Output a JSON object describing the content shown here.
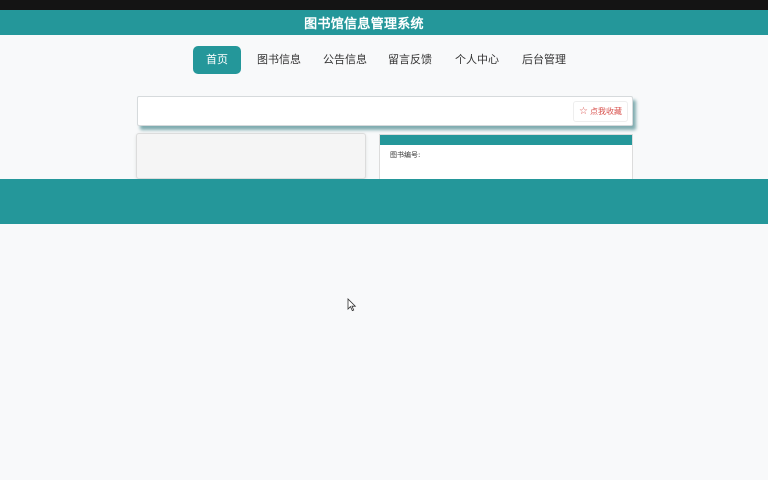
{
  "header": {
    "title": "图书馆信息管理系统"
  },
  "nav": {
    "items": [
      {
        "label": "首页",
        "active": true
      },
      {
        "label": "图书信息",
        "active": false
      },
      {
        "label": "公告信息",
        "active": false
      },
      {
        "label": "留言反馈",
        "active": false
      },
      {
        "label": "个人中心",
        "active": false
      },
      {
        "label": "后台管理",
        "active": false
      }
    ]
  },
  "search": {
    "favorite_label": "点我收藏",
    "favorite_icon": "star-outline-icon"
  },
  "detail": {
    "book_number_label": "图书编号:"
  },
  "colors": {
    "primary": "#24979a",
    "accent": "#d9534f",
    "background": "#f8f9fa"
  }
}
